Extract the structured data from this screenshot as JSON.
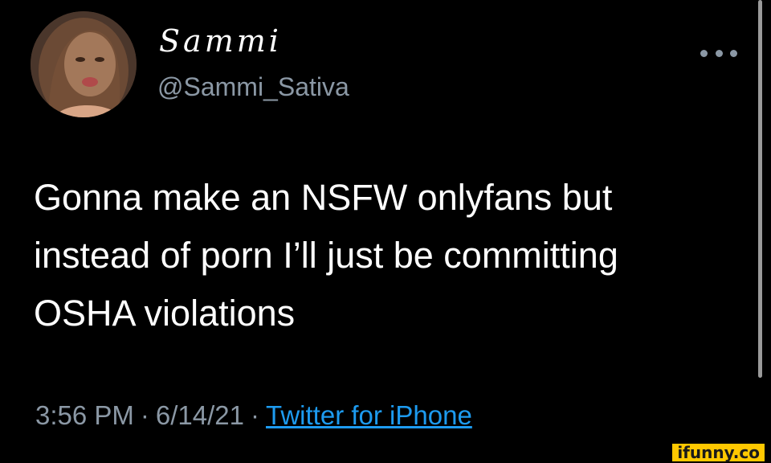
{
  "tweet": {
    "display_name": "Sammi",
    "handle": "@Sammi_Sativa",
    "text": "Gonna make an NSFW onlyfans but\ninstead of porn I’ll just be committing\nOSHA violations",
    "time": "3:56 PM",
    "date": "6/14/21",
    "separator": "·",
    "source": "Twitter for iPhone",
    "more_icon": "more-horizontal-icon",
    "avatar_icon": "profile-photo"
  },
  "watermark": {
    "text": "ifunny.co"
  },
  "colors": {
    "background": "#000000",
    "text": "#ffffff",
    "secondary": "#8b98a5",
    "link": "#1d9bf0",
    "watermark_bg": "#ffc800"
  }
}
